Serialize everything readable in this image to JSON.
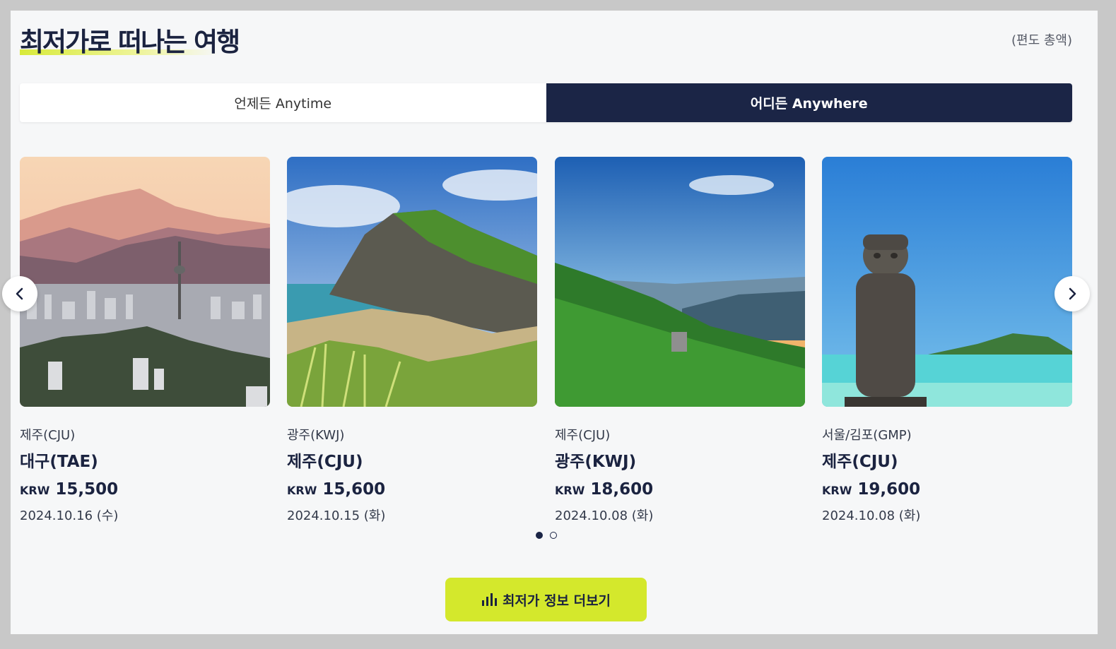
{
  "header": {
    "title": "최저가로 떠나는 여행",
    "note": "(편도 총액)"
  },
  "tabs": [
    {
      "label": "언제든 Anytime",
      "active": false
    },
    {
      "label": "어디든 Anywhere",
      "active": true
    }
  ],
  "cards": [
    {
      "origin": "제주(CJU)",
      "destination": "대구(TAE)",
      "currency": "KRW",
      "price": "15,500",
      "date": "2024.10.16 (수)",
      "image": "city-mountain-photo"
    },
    {
      "origin": "광주(KWJ)",
      "destination": "제주(CJU)",
      "currency": "KRW",
      "price": "15,600",
      "date": "2024.10.15 (화)",
      "image": "coastal-cliff-photo"
    },
    {
      "origin": "제주(CJU)",
      "destination": "광주(KWJ)",
      "currency": "KRW",
      "price": "18,600",
      "date": "2024.10.08 (화)",
      "image": "green-mountain-photo"
    },
    {
      "origin": "서울/김포(GMP)",
      "destination": "제주(CJU)",
      "currency": "KRW",
      "price": "19,600",
      "date": "2024.10.08 (화)",
      "image": "stone-statue-beach-photo"
    }
  ],
  "carousel": {
    "pages": 2,
    "current": 1
  },
  "more_button": {
    "label": "최저가 정보 더보기",
    "icon": "bar-chart-icon"
  },
  "colors": {
    "navy": "#1b2546",
    "accent": "#d4e82c",
    "background": "#f6f7f8"
  }
}
